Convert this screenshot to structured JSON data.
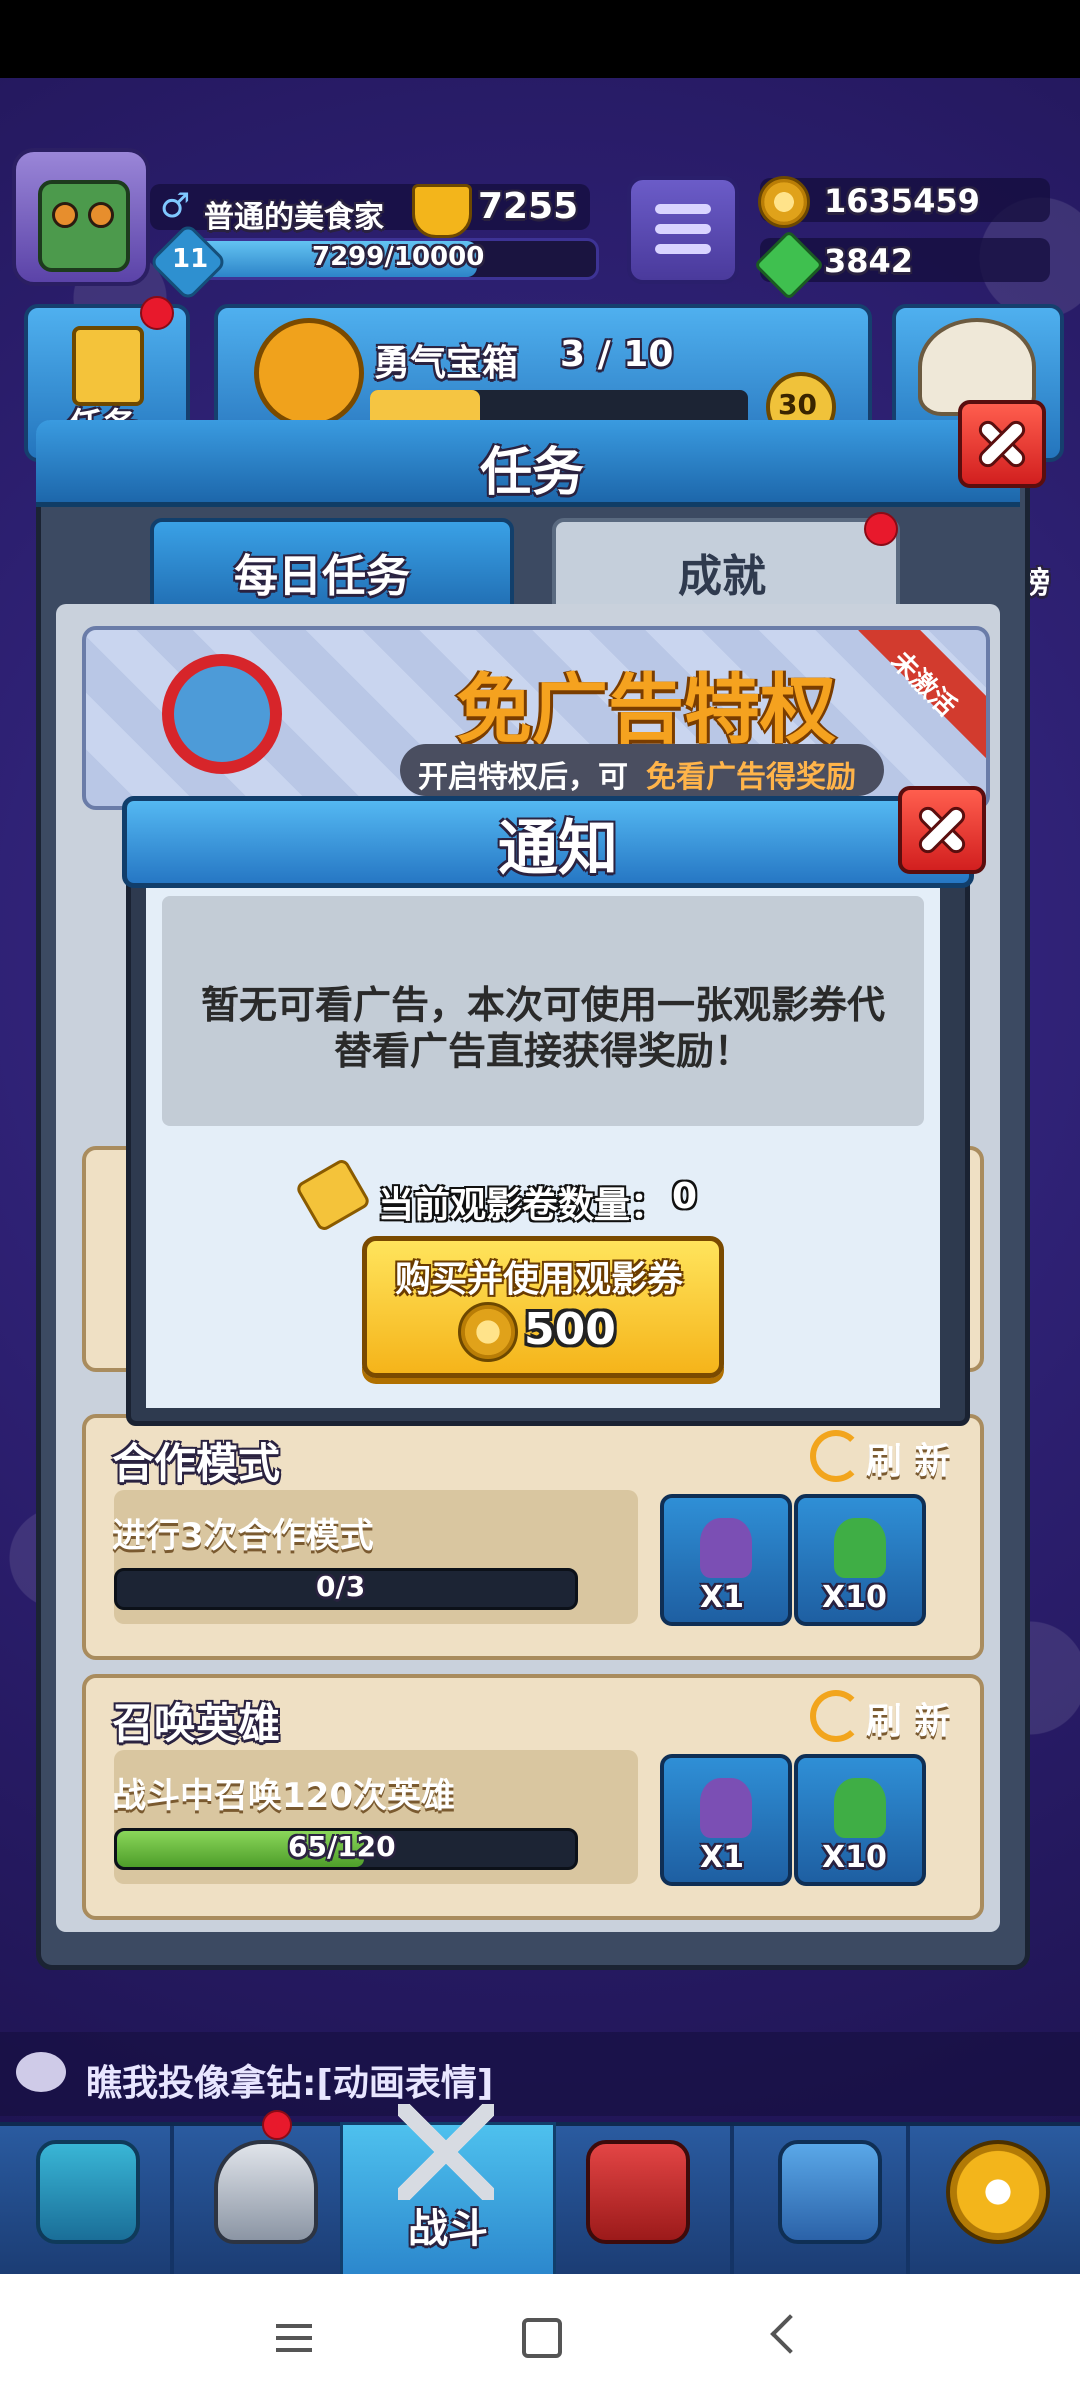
{
  "player": {
    "name": "普通的美食家",
    "trophies": "7255",
    "level": "11",
    "xp": "7299/10000"
  },
  "resources": {
    "coins": "1635459",
    "gems": "3842"
  },
  "behind": {
    "task_tile_label": "任务",
    "chest_title": "勇气宝箱",
    "chest_progress": "3 / 10",
    "chest_level": "30",
    "rank_label": "榜"
  },
  "task_panel": {
    "title": "任务",
    "tabs": [
      {
        "label": "每日任务"
      },
      {
        "label": "成就"
      }
    ],
    "ad_banner": {
      "title": "免广告特权",
      "subtitle_prefix": "开启特权后，可",
      "subtitle_highlight": "免看广告得奖励",
      "ribbon": "未激活"
    },
    "tasks": [
      {
        "name": "合作模式",
        "refresh": "刷 新",
        "desc": "进行3次合作模式",
        "progress": "0/3",
        "fraction": 0.0,
        "rewards": [
          "X1",
          "X10"
        ]
      },
      {
        "name": "召唤英雄",
        "refresh": "刷 新",
        "desc": "战斗中召唤120次英雄",
        "progress": "65/120",
        "fraction": 0.54,
        "rewards": [
          "X1",
          "X10"
        ]
      }
    ]
  },
  "dialog": {
    "title": "通知",
    "message_line1": "暂无可看广告，本次可使用一张观影券代",
    "message_line2": "替看广告直接获得奖励！",
    "ticket_label": "当前观影卷数量：",
    "ticket_count": "0",
    "buy_label": "购买并使用观影券",
    "buy_price": "500"
  },
  "chat": {
    "text": "瞧我投像拿钻:[动画表情]"
  },
  "bottom_nav": {
    "battle_label": "战斗"
  },
  "colors": {
    "accent_blue": "#2677c4",
    "gold": "#f5b41a",
    "close_red": "#d21f1f",
    "progress_green": "#5fb43a"
  }
}
